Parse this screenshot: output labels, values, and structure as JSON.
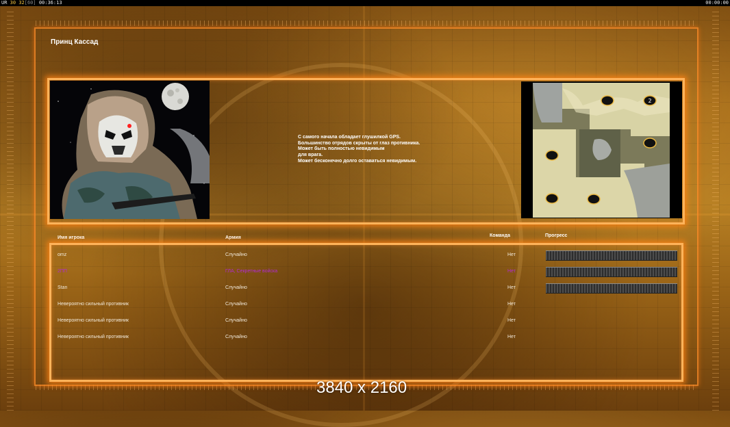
{
  "status_bar": {
    "left_prefix": "UR",
    "fps_a": "30",
    "fps_b": "32",
    "fps_max": "[60]",
    "elapsed": "00:36:13",
    "right_time": "00:00:00"
  },
  "general": {
    "name": "Принц Кассад",
    "description_lines": [
      "С самого начала обладает глушилкой GPS.",
      "Большинство отрядов скрыты от глаз противника.",
      "Может быть полностью невидимым",
      "для врага.",
      "Может бесконечно долго оставаться невидимым."
    ]
  },
  "table": {
    "headers": {
      "name": "Имя игрока",
      "army": "Армия",
      "team": "Команда",
      "progress": "Прогресс"
    },
    "rows": [
      {
        "name": "omz",
        "army": "Случайно",
        "team": "Нет",
        "has_progress": true,
        "highlight": false
      },
      {
        "name": "2ПП",
        "army": "ГЛА, Секретные войска",
        "team": "Нет",
        "has_progress": true,
        "highlight": true
      },
      {
        "name": "Stan",
        "army": "Случайно",
        "team": "Нет",
        "has_progress": true,
        "highlight": false
      },
      {
        "name": "Невероятно сильный противник",
        "army": "Случайно",
        "team": "Нет",
        "has_progress": false,
        "highlight": false
      },
      {
        "name": "Невероятно сильный противник",
        "army": "Случайно",
        "team": "Нет",
        "has_progress": false,
        "highlight": false
      },
      {
        "name": "Невероятно сильный противник",
        "army": "Случайно",
        "team": "Нет",
        "has_progress": false,
        "highlight": false
      }
    ]
  },
  "minimap": {
    "start_position_label": "2"
  },
  "watermark": "3840 x 2160",
  "colors": {
    "accent_orange": "#ffb35a",
    "highlight_purple": "#b12bd3",
    "background_amber": "#a76d1b"
  }
}
